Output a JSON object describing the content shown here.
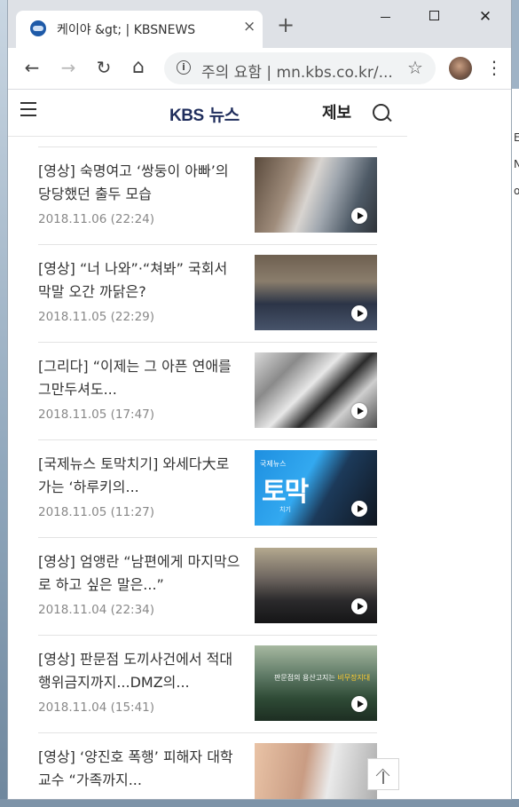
{
  "browser": {
    "tab_title": "케이야 &gt; | KBSNEWS",
    "tab_close": "×",
    "new_tab": "+",
    "window_close": "✕",
    "address_security_label": "주의 요함",
    "address_separator": "|",
    "address_url": "mn.kbs.co.kr/...",
    "info_glyph": "i",
    "back_glyph": "←",
    "forward_glyph": "→",
    "reload_glyph": "↻",
    "home_glyph": "⌂",
    "star_glyph": "☆",
    "menu_glyph": "⋮"
  },
  "site": {
    "logo": "KBS 뉴스",
    "logo_kbs": "KBS",
    "logo_news": "뉴스",
    "report_label": "제보"
  },
  "articles": [
    {
      "title": "[영상] 숙명여고 ‘쌍둥이 아빠’의 당당했던 출두 모습",
      "date": "2018.11.06 (22:24)"
    },
    {
      "title": "[영상] “너 나와”·“쳐봐” 국회서 막말 오간 까닭은?",
      "date": "2018.11.05 (22:29)"
    },
    {
      "title": "[그리다] “이제는 그 아픈 연애를 그만두셔도...",
      "date": "2018.11.05 (17:47)"
    },
    {
      "title": "[국제뉴스 토막치기] 와세다大로 가는 ‘하루키의...",
      "date": "2018.11.05 (11:27)"
    },
    {
      "title": "[영상] 엄앵란 “남편에게 마지막으로 하고 싶은 말은...”",
      "date": "2018.11.04 (22:34)"
    },
    {
      "title": "[영상] 판문점 도끼사건에서 적대행위금지까지...DMZ의...",
      "date": "2018.11.04 (15:41)"
    },
    {
      "title": "[영상] ‘양진호 폭행’ 피해자 대학교수 “가족까지...",
      "date": ""
    }
  ],
  "thumb_text": {
    "t4_label": "국제뉴스",
    "t4_big": "토막",
    "t4_small": "치기",
    "t6_caption_a": "판문점의 용산고지는",
    "t6_caption_b": "비무장지대"
  },
  "bg_window": {
    "frag1": "E",
    "frag2": "N",
    "frag3": "o"
  }
}
